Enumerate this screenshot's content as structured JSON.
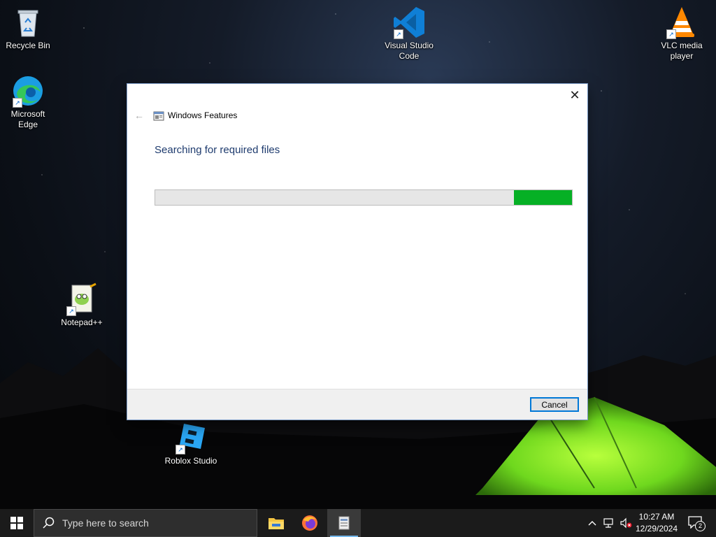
{
  "desktop": {
    "icons": [
      {
        "label": "Recycle Bin"
      },
      {
        "label": "Microsoft Edge"
      },
      {
        "label": "Visual Studio Code"
      },
      {
        "label": "VLC media player"
      },
      {
        "label": "Notepad++"
      },
      {
        "label": "Roblox Studio"
      }
    ]
  },
  "dialog": {
    "title": "Windows Features",
    "heading": "Searching for required files",
    "progress": {
      "fill_start": 0.86,
      "fill_end": 1.0,
      "color": "#06b025"
    },
    "cancel_label": "Cancel",
    "close_glyph": "✕",
    "back_glyph": "←"
  },
  "taskbar": {
    "search_placeholder": "Type here to search",
    "apps": [
      "file-explorer-icon",
      "firefox-icon",
      "windows-features-icon"
    ],
    "clock": {
      "time": "10:27 AM",
      "date": "12/29/2024"
    },
    "notification_count": "2"
  }
}
